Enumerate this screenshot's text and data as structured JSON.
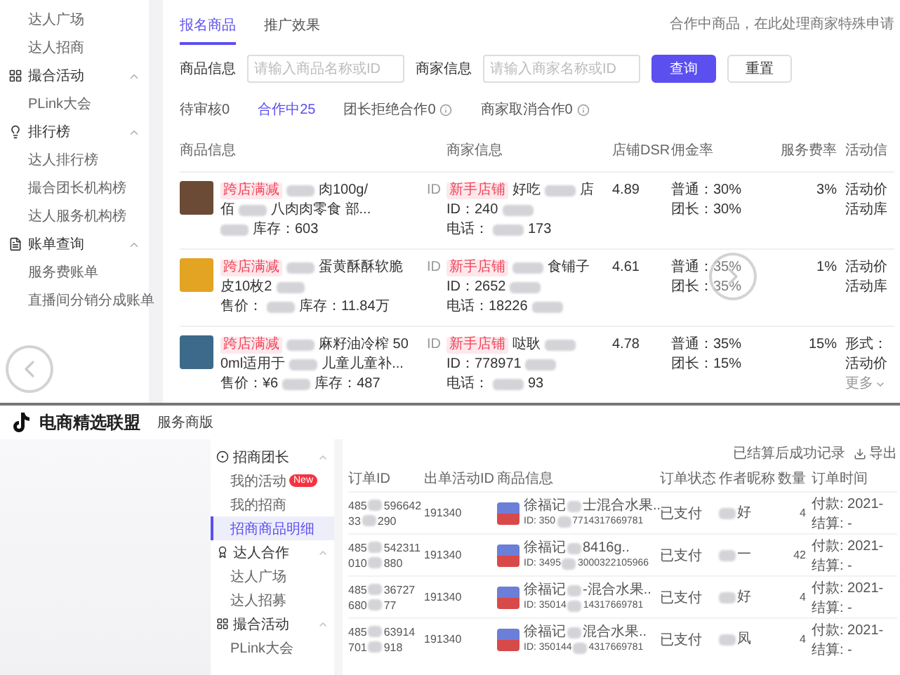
{
  "top_panel": {
    "sidebar": [
      {
        "kind": "item",
        "label": "达人广场"
      },
      {
        "kind": "item",
        "label": "达人招商"
      },
      {
        "kind": "section",
        "label": "撮合活动",
        "expanded": true
      },
      {
        "kind": "item",
        "label": "PLink大会"
      },
      {
        "kind": "section",
        "label": "排行榜",
        "expanded": true
      },
      {
        "kind": "item",
        "label": "达人排行榜"
      },
      {
        "kind": "item",
        "label": "撮合团长机构榜"
      },
      {
        "kind": "item",
        "label": "达人服务机构榜"
      },
      {
        "kind": "section",
        "label": "账单查询",
        "expanded": true
      },
      {
        "kind": "item",
        "label": "服务费账单"
      },
      {
        "kind": "item",
        "label": "直播间分销分成账单"
      }
    ],
    "tabs": [
      {
        "label": "报名商品",
        "selected": true
      },
      {
        "label": "推广效果",
        "selected": false
      }
    ],
    "hint": "合作中商品，在此处理商家特殊申请",
    "filters": [
      {
        "label": "商品信息",
        "placeholder": "请输入商品名称或ID"
      },
      {
        "label": "商家信息",
        "placeholder": "请输入商家名称或ID"
      }
    ],
    "buttons": [
      {
        "label": "查询",
        "kind": "primary"
      },
      {
        "label": "重置",
        "kind": "default"
      }
    ],
    "status_tabs": [
      {
        "label": "待审核0",
        "selected": false,
        "info": false
      },
      {
        "label": "合作中25",
        "selected": true,
        "info": false
      },
      {
        "label": "团长拒绝合作0",
        "selected": false,
        "info": true
      },
      {
        "label": "商家取消合作0",
        "selected": false,
        "info": true
      }
    ],
    "table": {
      "columns": [
        "商品信息",
        "商家信息",
        "店铺DSR",
        "佣金率",
        "服务费率",
        "活动信"
      ],
      "rows": [
        {
          "product": [
            [
              {
                "kind": "tag",
                "text": "跨店满减"
              },
              {
                "kind": "blur"
              },
              {
                "kind": "text",
                "text": "肉100g/"
              }
            ],
            [
              {
                "kind": "text",
                "text": "佰"
              },
              {
                "kind": "blur"
              },
              {
                "kind": "text",
                "text": "八肉肉零食 部..."
              }
            ],
            [
              {
                "kind": "blur"
              },
              {
                "kind": "text",
                "text": "库存：603"
              }
            ]
          ],
          "id_label": "ID",
          "merchant": [
            [
              {
                "kind": "tag",
                "text": "新手店铺"
              },
              {
                "kind": "text",
                "text": "好吃"
              },
              {
                "kind": "blur"
              },
              {
                "kind": "text",
                "text": "店"
              }
            ],
            [
              {
                "kind": "text",
                "text": "ID：240"
              },
              {
                "kind": "blur"
              }
            ],
            [
              {
                "kind": "text",
                "text": "电话："
              },
              {
                "kind": "blur"
              },
              {
                "kind": "text",
                "text": "173"
              }
            ]
          ],
          "dsr": "4.89",
          "commission": [
            "普通：30%",
            "团长：30%"
          ],
          "service_rate": "3%",
          "activity": [
            {
              "kind": "text",
              "text": "活动价"
            },
            {
              "kind": "text",
              "text": "活动库"
            }
          ]
        },
        {
          "product": [
            [
              {
                "kind": "tag",
                "text": "跨店满减"
              },
              {
                "kind": "blur"
              },
              {
                "kind": "text",
                "text": "蛋黄酥酥软脆"
              }
            ],
            [
              {
                "kind": "text",
                "text": "皮10枚2"
              },
              {
                "kind": "blur"
              }
            ],
            [
              {
                "kind": "text",
                "text": "售价："
              },
              {
                "kind": "blur"
              },
              {
                "kind": "text",
                "text": "库存：11.84万"
              }
            ]
          ],
          "id_label": "ID",
          "merchant": [
            [
              {
                "kind": "tag",
                "text": "新手店铺"
              },
              {
                "kind": "blur"
              },
              {
                "kind": "text",
                "text": "食铺子"
              }
            ],
            [
              {
                "kind": "text",
                "text": "ID：2652"
              },
              {
                "kind": "blur"
              }
            ],
            [
              {
                "kind": "text",
                "text": "电话：18226"
              },
              {
                "kind": "blur"
              }
            ]
          ],
          "dsr": "4.61",
          "commission": [
            "普通：35%",
            "团长：35%"
          ],
          "service_rate": "1%",
          "activity": [
            {
              "kind": "text",
              "text": "活动价"
            },
            {
              "kind": "text",
              "text": "活动库"
            }
          ]
        },
        {
          "product": [
            [
              {
                "kind": "tag",
                "text": "跨店满减"
              },
              {
                "kind": "blur"
              },
              {
                "kind": "text",
                "text": "麻籽油冷榨 50"
              }
            ],
            [
              {
                "kind": "text",
                "text": "0ml适用于"
              },
              {
                "kind": "blur"
              },
              {
                "kind": "text",
                "text": "儿童儿童补..."
              }
            ],
            [
              {
                "kind": "text",
                "text": "售价：¥6"
              },
              {
                "kind": "blur"
              },
              {
                "kind": "text",
                "text": "库存：487"
              }
            ]
          ],
          "id_label": "ID",
          "merchant": [
            [
              {
                "kind": "tag",
                "text": "新手店铺"
              },
              {
                "kind": "text",
                "text": "哒耿"
              },
              {
                "kind": "blur"
              }
            ],
            [
              {
                "kind": "text",
                "text": "ID：778971"
              },
              {
                "kind": "blur"
              }
            ],
            [
              {
                "kind": "text",
                "text": "电话："
              },
              {
                "kind": "blur"
              },
              {
                "kind": "text",
                "text": "93"
              }
            ]
          ],
          "dsr": "4.78",
          "commission": [
            "普通：35%",
            "团长：15%"
          ],
          "service_rate": "15%",
          "activity": [
            {
              "kind": "text",
              "text": "形式："
            },
            {
              "kind": "text",
              "text": "活动价"
            },
            {
              "kind": "more",
              "text": "更多"
            }
          ]
        }
      ]
    }
  },
  "bottom_panel": {
    "brand": {
      "name": "电商精选联盟",
      "edition": "服务商版"
    },
    "sidebar": [
      {
        "kind": "section",
        "label": "招商团长",
        "expanded": true
      },
      {
        "kind": "item",
        "label": "我的活动",
        "badge": "New",
        "selected": false
      },
      {
        "kind": "item",
        "label": "我的招商",
        "selected": false
      },
      {
        "kind": "item",
        "label": "招商商品明细",
        "selected": true
      },
      {
        "kind": "section",
        "label": "达人合作",
        "expanded": true
      },
      {
        "kind": "item",
        "label": "达人广场",
        "selected": false
      },
      {
        "kind": "item",
        "label": "达人招募",
        "selected": false
      },
      {
        "kind": "section",
        "label": "撮合活动",
        "expanded": true
      },
      {
        "kind": "item",
        "label": "PLink大会",
        "selected": false
      }
    ],
    "toolbar": {
      "note": "已结算后成功记录",
      "export": "导出"
    },
    "table": {
      "columns": [
        "订单ID",
        "出单活动ID",
        "商品信息",
        "订单状态",
        "作者昵称",
        "数量",
        "订单时间"
      ],
      "rows": [
        {
          "order_id": [
            [
              {
                "kind": "text",
                "text": "485"
              },
              {
                "kind": "blur"
              },
              {
                "kind": "text",
                "text": "596642"
              }
            ],
            [
              {
                "kind": "text",
                "text": "33"
              },
              {
                "kind": "blur"
              },
              {
                "kind": "text",
                "text": "290"
              }
            ]
          ],
          "activity_id": "191340",
          "title": [
            {
              "kind": "text",
              "text": "徐福记"
            },
            {
              "kind": "blur"
            },
            {
              "kind": "text",
              "text": "士混合水果.."
            }
          ],
          "product_id": [
            {
              "kind": "text",
              "text": "ID: 350"
            },
            {
              "kind": "blur"
            },
            {
              "kind": "text",
              "text": "7714317669781"
            }
          ],
          "status": "已支付",
          "author": [
            {
              "kind": "blur"
            },
            {
              "kind": "text",
              "text": "好"
            }
          ],
          "count": "4",
          "time": [
            "付款: 2021-",
            "结算: -"
          ]
        },
        {
          "order_id": [
            [
              {
                "kind": "text",
                "text": "485"
              },
              {
                "kind": "blur"
              },
              {
                "kind": "text",
                "text": "542311"
              }
            ],
            [
              {
                "kind": "text",
                "text": "010"
              },
              {
                "kind": "blur"
              },
              {
                "kind": "text",
                "text": "880"
              }
            ]
          ],
          "activity_id": "191340",
          "title": [
            {
              "kind": "text",
              "text": "徐福记"
            },
            {
              "kind": "blur"
            },
            {
              "kind": "text",
              "text": "8416g.."
            }
          ],
          "product_id": [
            {
              "kind": "text",
              "text": "ID: 3495"
            },
            {
              "kind": "blur"
            },
            {
              "kind": "text",
              "text": "3000322105966"
            }
          ],
          "status": "已支付",
          "author": [
            {
              "kind": "blur"
            },
            {
              "kind": "text",
              "text": "一"
            }
          ],
          "count": "42",
          "time": [
            "付款: 2021-",
            "结算: -"
          ]
        },
        {
          "order_id": [
            [
              {
                "kind": "text",
                "text": "485"
              },
              {
                "kind": "blur"
              },
              {
                "kind": "text",
                "text": "36727"
              }
            ],
            [
              {
                "kind": "text",
                "text": "680"
              },
              {
                "kind": "blur"
              },
              {
                "kind": "text",
                "text": "77"
              }
            ]
          ],
          "activity_id": "191340",
          "title": [
            {
              "kind": "text",
              "text": "徐福记"
            },
            {
              "kind": "blur"
            },
            {
              "kind": "text",
              "text": "-混合水果.."
            }
          ],
          "product_id": [
            {
              "kind": "text",
              "text": "ID: 35014"
            },
            {
              "kind": "blur"
            },
            {
              "kind": "text",
              "text": "14317669781"
            }
          ],
          "status": "已支付",
          "author": [
            {
              "kind": "blur"
            },
            {
              "kind": "text",
              "text": "好"
            }
          ],
          "count": "4",
          "time": [
            "付款: 2021-",
            "结算: -"
          ]
        },
        {
          "order_id": [
            [
              {
                "kind": "text",
                "text": "485"
              },
              {
                "kind": "blur"
              },
              {
                "kind": "text",
                "text": "63914"
              }
            ],
            [
              {
                "kind": "text",
                "text": "701"
              },
              {
                "kind": "blur"
              },
              {
                "kind": "text",
                "text": "918"
              }
            ]
          ],
          "activity_id": "191340",
          "title": [
            {
              "kind": "text",
              "text": "徐福记"
            },
            {
              "kind": "blur"
            },
            {
              "kind": "text",
              "text": "混合水果.."
            }
          ],
          "product_id": [
            {
              "kind": "text",
              "text": "ID: 350144"
            },
            {
              "kind": "blur"
            },
            {
              "kind": "text",
              "text": "4317669781"
            }
          ],
          "status": "已支付",
          "author": [
            {
              "kind": "blur"
            },
            {
              "kind": "text",
              "text": "凤"
            }
          ],
          "count": "4",
          "time": [
            "付款: 2021-",
            "结算: -"
          ]
        }
      ]
    }
  }
}
